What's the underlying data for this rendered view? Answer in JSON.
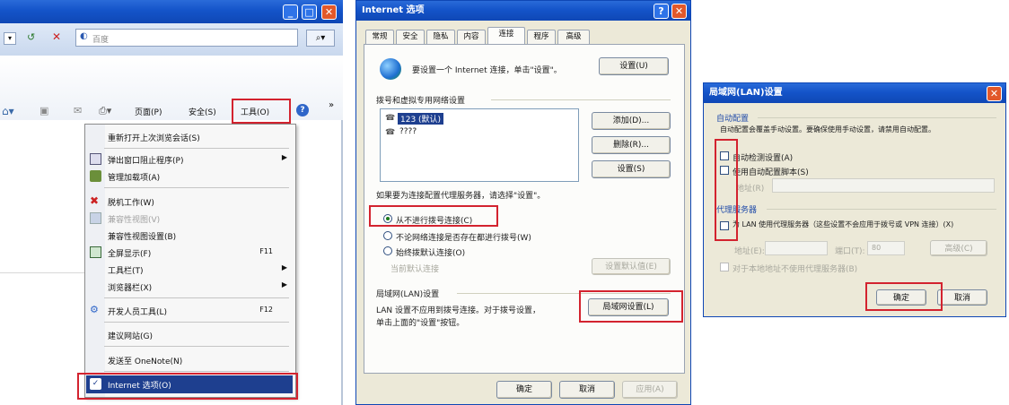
{
  "ie": {
    "search_placeholder": "百度",
    "cmd_page": "页面(P)",
    "cmd_safety": "安全(S)",
    "cmd_tools": "工具(O)",
    "menu": [
      {
        "label": "重新打开上次浏览会话(S)",
        "shortcut": "",
        "arrow": false,
        "icon": "none",
        "disabled": false
      },
      {
        "label": "弹出窗口阻止程序(P)",
        "shortcut": "",
        "arrow": true,
        "icon": "popup-blocker-icon",
        "disabled": false
      },
      {
        "label": "管理加载项(A)",
        "shortcut": "",
        "arrow": false,
        "icon": "addons-icon",
        "disabled": false
      },
      {
        "label": "脱机工作(W)",
        "shortcut": "",
        "arrow": false,
        "icon": "offline-icon",
        "disabled": false
      },
      {
        "label": "兼容性视图(V)",
        "shortcut": "",
        "arrow": false,
        "icon": "compat-icon",
        "disabled": true
      },
      {
        "label": "兼容性视图设置(B)",
        "shortcut": "",
        "arrow": false,
        "icon": "none",
        "disabled": false
      },
      {
        "label": "全屏显示(F)",
        "shortcut": "F11",
        "arrow": false,
        "icon": "fullscreen-icon",
        "disabled": false
      },
      {
        "label": "工具栏(T)",
        "shortcut": "",
        "arrow": true,
        "icon": "none",
        "disabled": false
      },
      {
        "label": "浏览器栏(X)",
        "shortcut": "",
        "arrow": true,
        "icon": "none",
        "disabled": false
      },
      {
        "label": "开发人员工具(L)",
        "shortcut": "F12",
        "arrow": false,
        "icon": "devtools-icon",
        "disabled": false
      },
      {
        "label": "建议网站(G)",
        "shortcut": "",
        "arrow": false,
        "icon": "none",
        "disabled": false
      },
      {
        "label": "发送至 OneNote(N)",
        "shortcut": "",
        "arrow": false,
        "icon": "none",
        "disabled": false
      },
      {
        "label": "Internet 选项(O)",
        "shortcut": "",
        "arrow": false,
        "icon": "internet-options-icon",
        "disabled": false
      }
    ]
  },
  "inet": {
    "title": "Internet 选项",
    "tabs": [
      "常规",
      "安全",
      "隐私",
      "内容",
      "连接",
      "程序",
      "高级"
    ],
    "active_tab": "连接",
    "setup_text": "要设置一个 Internet 连接，单击\"设置\"。",
    "setup_button": "设置(U)",
    "dialup_group": "拨号和虚拟专用网络设置",
    "connections": [
      "123 (默认)",
      "????"
    ],
    "add_button": "添加(D)...",
    "remove_button": "删除(R)...",
    "settings_button": "设置(S)",
    "proxy_hint": "如果要为连接配置代理服务器，请选择\"设置\"。",
    "radio_never": "从不进行拨号连接(C)",
    "radio_no_network": "不论网络连接是否存在都进行拨号(W)",
    "radio_always": "始终拨默认连接(O)",
    "current_label": "当前默认连接",
    "set_default_button": "设置默认值(E)",
    "lan_group": "局域网(LAN)设置",
    "lan_text_1": "LAN 设置不应用到拨号连接。对于拨号设置，",
    "lan_text_2": "单击上面的\"设置\"按钮。",
    "lan_button": "局域网设置(L)",
    "ok": "确定",
    "cancel": "取消",
    "apply": "应用(A)"
  },
  "lan": {
    "title": "局域网(LAN)设置",
    "auto_group": "自动配置",
    "auto_desc": "自动配置会覆盖手动设置。要确保使用手动设置，请禁用自动配置。",
    "auto_detect": "自动检测设置(A)",
    "use_script": "使用自动配置脚本(S)",
    "address_label": "地址(R)",
    "proxy_group": "代理服务器",
    "proxy_check": "为 LAN 使用代理服务器（这些设置不会应用于拨号或 VPN 连接）(X)",
    "addr_label": "地址(E):",
    "port_label": "端口(T):",
    "port_value": "80",
    "advanced_button": "高级(C)",
    "bypass": "对于本地地址不使用代理服务器(B)",
    "ok": "确定",
    "cancel": "取消"
  },
  "colors": {
    "highlight": "#d3232f",
    "xp_blue": "#0f47b5",
    "menu_selected": "#1e3f8f"
  }
}
